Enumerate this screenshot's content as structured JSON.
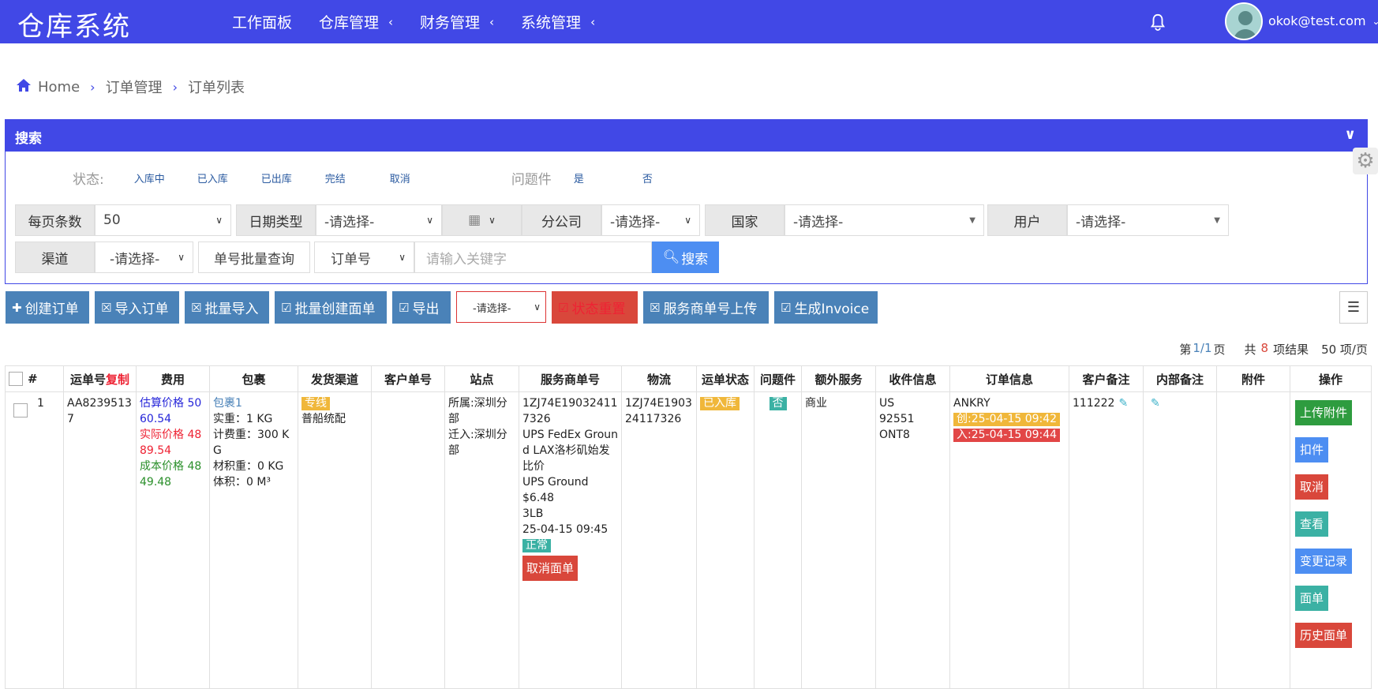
{
  "topbar": {
    "logo": "仓库系统",
    "nav": [
      {
        "label": "工作面板",
        "chevron": false
      },
      {
        "label": "仓库管理",
        "chevron": true
      },
      {
        "label": "财务管理",
        "chevron": true
      },
      {
        "label": "系统管理",
        "chevron": true
      }
    ],
    "user": "okok@test.com",
    "bell_icon": "bell-icon"
  },
  "breadcrumb": {
    "home": "Home",
    "items": [
      "订单管理",
      "订单列表"
    ]
  },
  "search": {
    "title": "搜索",
    "status_label": "状态:",
    "status_opts": [
      "入库中",
      "已入库",
      "已出库",
      "完结",
      "取消"
    ],
    "problem_label": "问题件",
    "problem_opts": [
      "是",
      "否"
    ],
    "per_page_label": "每页条数",
    "per_page_value": "50",
    "date_type_label": "日期类型",
    "date_type_value": "-请选择-",
    "branch_label": "分公司",
    "branch_value": "-请选择-",
    "country_label": "国家",
    "country_value": "-请选择-",
    "user_label": "用户",
    "user_value": "-请选择-",
    "channel_label": "渠道",
    "channel_value": "-请选择-",
    "batch_query": "单号批量查询",
    "order_no": "订单号",
    "keyword_placeholder": "请输入关键字",
    "search_btn": "搜索"
  },
  "toolbar": {
    "create": "创建订单",
    "import": "导入订单",
    "batch_import": "批量导入",
    "batch_label": "批量创建面单",
    "export": "导出",
    "select": "-请选择-",
    "reset_status": "状态重置",
    "upload_sp": "服务商单号上传",
    "invoice": "生成Invoice"
  },
  "pager": {
    "prefix": "第",
    "page": "1/1",
    "suffix": "页",
    "total_prefix": "共",
    "total": "8",
    "total_suffix": "项结果",
    "per_page": "50 项/页"
  },
  "table": {
    "headers": [
      "#",
      "运单号",
      "费用",
      "包裹",
      "发货渠道",
      "客户单号",
      "站点",
      "服务商单号",
      "物流",
      "运单状态",
      "问题件",
      "额外服务",
      "收件信息",
      "订单信息",
      "客户备注",
      "内部备注",
      "附件",
      "操作"
    ],
    "copy_label": "复制",
    "row": {
      "index": "1",
      "waybill": "AA82395137",
      "fee_est": "估算价格 5060.54",
      "fee_actual": "实际价格 4889.54",
      "fee_cost": "成本价格 4849.48",
      "pkg_link": "包裹1",
      "pkg_weight": "实重：1 KG",
      "pkg_charge": "计费重：300 KG",
      "pkg_vol_weight": "材积重：0 KG",
      "pkg_volume": "体积：0 M³",
      "channel_tag": "专线",
      "channel_name": "普船统配",
      "site_belong": "所属:深圳分部",
      "site_move": "迁入:深圳分部",
      "sp_no": "1ZJ74E190324117326",
      "sp_service": "UPS FedEx Ground LAX洛杉矶始发比价",
      "sp_ground": "UPS Ground",
      "sp_price": "$6.48",
      "sp_weight": "3LB",
      "sp_time": "25-04-15 09:45",
      "sp_status": "正常",
      "sp_cancel": "取消面单",
      "logistics": "1ZJ74E190324117326",
      "status": "已入库",
      "problem": "否",
      "extra": "商业",
      "rcv_country": "US",
      "rcv_zip": "92551",
      "rcv_code": "ONT8",
      "ord_name": "ANKRY",
      "ord_created": "创:25-04-15 09:42",
      "ord_in": "入:25-04-15 09:44",
      "customer_note": "111222",
      "actions": [
        "上传附件",
        "扣件",
        "取消",
        "查看",
        "变更记录",
        "面单",
        "历史面单"
      ]
    }
  }
}
